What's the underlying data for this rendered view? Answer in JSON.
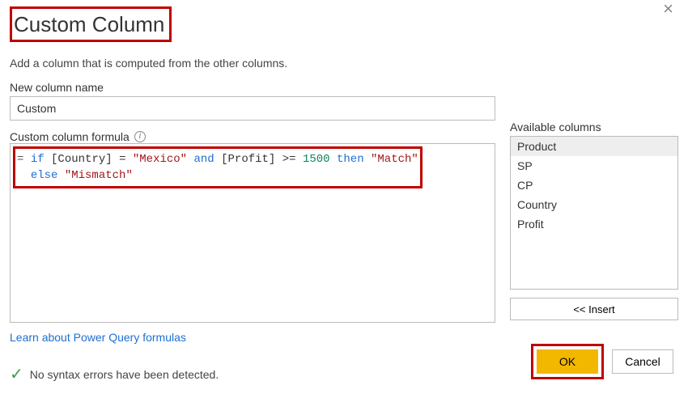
{
  "dialog": {
    "title": "Custom Column",
    "subtitle": "Add a column that is computed from the other columns.",
    "close": "×"
  },
  "name": {
    "label": "New column name",
    "value": "Custom"
  },
  "formula": {
    "label": "Custom column formula",
    "tokens": {
      "eq": "=",
      "if": "if",
      "col_country": "[Country]",
      "op_eq": "=",
      "str_mexico": "\"Mexico\"",
      "and": "and",
      "col_profit": "[Profit]",
      "op_ge": ">=",
      "num_1500": "1500",
      "then": "then",
      "str_match": "\"Match\"",
      "else": "else",
      "str_mismatch": "\"Mismatch\""
    }
  },
  "available": {
    "label": "Available columns",
    "items": [
      "Product",
      "SP",
      "CP",
      "Country",
      "Profit"
    ],
    "selected_index": 0
  },
  "insert": {
    "label": "<< Insert"
  },
  "link": {
    "label": "Learn about Power Query formulas"
  },
  "status": {
    "text": "No syntax errors have been detected."
  },
  "buttons": {
    "ok": "OK",
    "cancel": "Cancel"
  }
}
